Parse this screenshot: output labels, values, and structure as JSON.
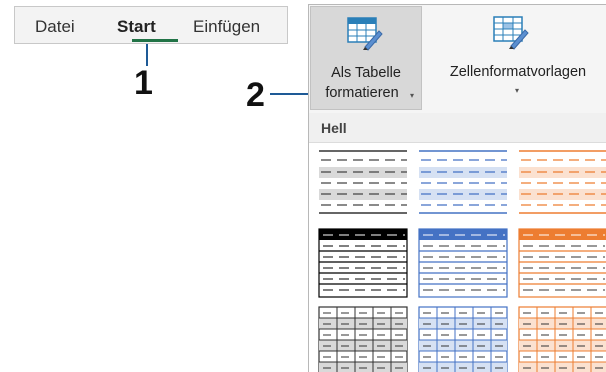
{
  "ribbon_tabs": {
    "items": [
      {
        "label": "Datei"
      },
      {
        "label": "Start",
        "active": true
      },
      {
        "label": "Einfügen"
      }
    ]
  },
  "callouts": {
    "one": "1",
    "two": "2"
  },
  "panel": {
    "format_as_table": {
      "line1": "Als Tabelle",
      "line2": "formatieren",
      "caret": "▾"
    },
    "cell_styles": {
      "label": "Zellenformatvorlagen",
      "caret": "▾"
    },
    "section_label": "Hell"
  },
  "colors": {
    "ribbon_accent": "#217346",
    "callout_line": "#1e5a96",
    "style_black": "#000000",
    "style_blue": "#4472c4",
    "style_orange": "#ed7d31"
  }
}
